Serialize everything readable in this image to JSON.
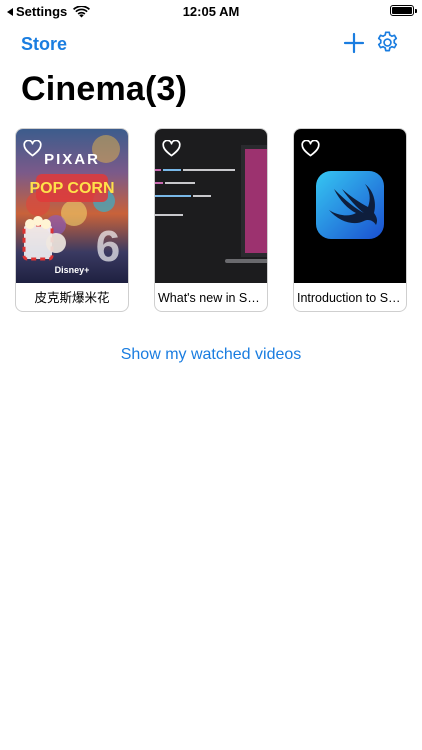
{
  "status_bar": {
    "back_label": "Settings",
    "time": "12:05 AM",
    "wifi_icon": "wifi-icon",
    "battery_icon": "battery-icon"
  },
  "nav": {
    "back_label": "Store",
    "add_icon": "plus-icon",
    "settings_icon": "gear-icon",
    "accent": "#1a7de0"
  },
  "title": "Cinema(3)",
  "videos": [
    {
      "title": "皮克斯爆米花",
      "thumb": "pixar-popcorn-poster",
      "favorite_icon": "heart-outline-icon",
      "poster_text": "PIXAR",
      "poster_brand": "Disney+"
    },
    {
      "title": "What's new in Swift",
      "thumb": "code-on-laptop",
      "favorite_icon": "heart-outline-icon"
    },
    {
      "title": "Introduction to SwiftUI",
      "thumb": "swift-logo",
      "favorite_icon": "heart-outline-icon"
    }
  ],
  "watched_link": "Show my watched videos"
}
